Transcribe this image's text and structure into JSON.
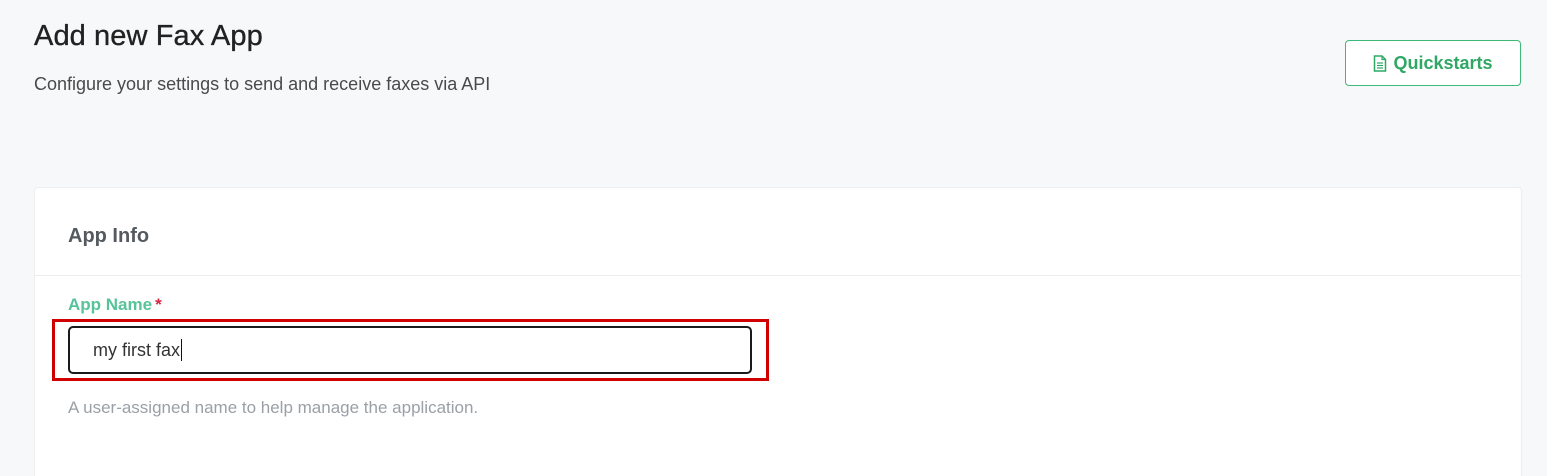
{
  "header": {
    "title": "Add new Fax App",
    "subtitle": "Configure your settings to send and receive faxes via API",
    "quickstarts_label": "Quickstarts",
    "quickstarts_icon": "document-icon"
  },
  "card": {
    "title": "App Info",
    "field": {
      "label": "App Name",
      "required_marker": "*",
      "value": "my first fax",
      "help": "A user-assigned name to help manage the application."
    }
  },
  "colors": {
    "accent": "#3fb97a",
    "label": "#56c39a",
    "required": "#d7263d",
    "highlight": "#d00000"
  }
}
